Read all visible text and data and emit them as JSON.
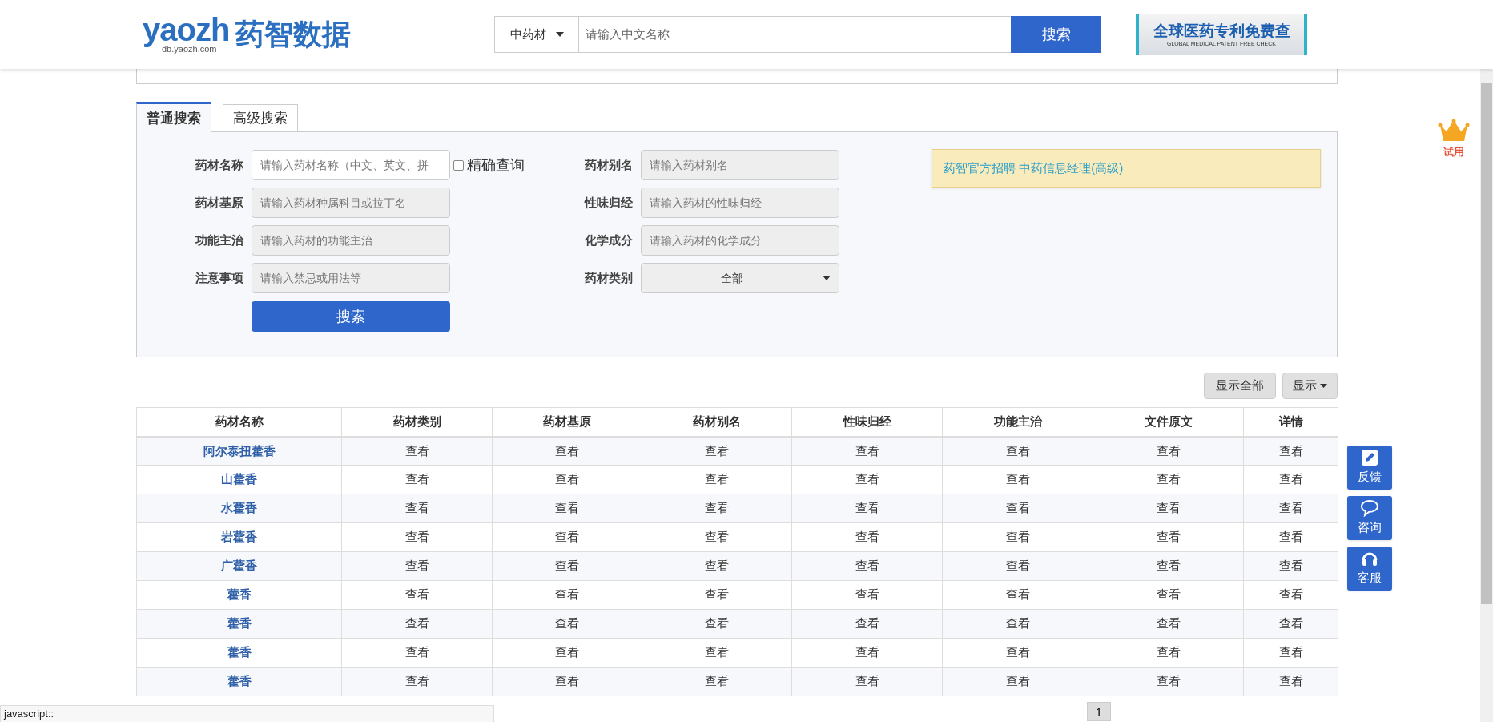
{
  "header": {
    "logo_text": "yaozh",
    "logo_cn": "药智数据",
    "logo_sub": "db.yaozh.com",
    "search": {
      "category": "中药材",
      "placeholder": "请输入中文名称",
      "button": "搜索"
    },
    "banner": {
      "title": "全球医药专利免费查",
      "subtitle": "GLOBAL MEDICAL PATENT FREE CHECK"
    }
  },
  "tabs": [
    {
      "label": "普通搜索",
      "selected": true
    },
    {
      "label": "高级搜索",
      "selected": false
    }
  ],
  "form": {
    "left": [
      {
        "label": "药材名称",
        "placeholder": "请输入药材名称（中文、英文、拼",
        "kind": "input",
        "active": true
      },
      {
        "label": "药材基原",
        "placeholder": "请输入药材种属科目或拉丁名",
        "kind": "input",
        "active": false
      },
      {
        "label": "功能主治",
        "placeholder": "请输入药材的功能主治",
        "kind": "input",
        "active": false
      },
      {
        "label": "注意事项",
        "placeholder": "请输入禁忌或用法等",
        "kind": "input",
        "active": false
      }
    ],
    "exact": {
      "label": "精确查询",
      "checked": false
    },
    "right": [
      {
        "label": "药材别名",
        "placeholder": "请输入药材别名",
        "kind": "input"
      },
      {
        "label": "性味归经",
        "placeholder": "请输入药材的性味归经",
        "kind": "input"
      },
      {
        "label": "化学成分",
        "placeholder": "请输入药材的化学成分",
        "kind": "input"
      },
      {
        "label": "药材类别",
        "value": "全部",
        "kind": "select"
      }
    ],
    "submit": "搜索"
  },
  "notice": "药智官方招聘 中药信息经理(高级)",
  "toolbar": {
    "show_all": "显示全部",
    "show": "显示"
  },
  "table": {
    "columns": [
      "药材名称",
      "药材类别",
      "药材基原",
      "药材别名",
      "性味归经",
      "功能主治",
      "文件原文",
      "详情"
    ],
    "rows": [
      [
        "阿尔泰扭藿香",
        "查看",
        "查看",
        "查看",
        "查看",
        "查看",
        "查看",
        "查看"
      ],
      [
        "山藿香",
        "查看",
        "查看",
        "查看",
        "查看",
        "查看",
        "查看",
        "查看"
      ],
      [
        "水藿香",
        "查看",
        "查看",
        "查看",
        "查看",
        "查看",
        "查看",
        "查看"
      ],
      [
        "岩藿香",
        "查看",
        "查看",
        "查看",
        "查看",
        "查看",
        "查看",
        "查看"
      ],
      [
        "广藿香",
        "查看",
        "查看",
        "查看",
        "查看",
        "查看",
        "查看",
        "查看"
      ],
      [
        "藿香",
        "查看",
        "查看",
        "查看",
        "查看",
        "查看",
        "查看",
        "查看"
      ],
      [
        "藿香",
        "查看",
        "查看",
        "查看",
        "查看",
        "查看",
        "查看",
        "查看"
      ],
      [
        "藿香",
        "查看",
        "查看",
        "查看",
        "查看",
        "查看",
        "查看",
        "查看"
      ],
      [
        "藿香",
        "查看",
        "查看",
        "查看",
        "查看",
        "查看",
        "查看",
        "查看"
      ]
    ]
  },
  "trial": "试用",
  "side_buttons": [
    {
      "label": "反馈",
      "kind": "pencil"
    },
    {
      "label": "咨询",
      "kind": "chat"
    },
    {
      "label": "客服",
      "kind": "headset"
    }
  ],
  "pagination": {
    "current": "1"
  },
  "status_bar": "javascript::"
}
